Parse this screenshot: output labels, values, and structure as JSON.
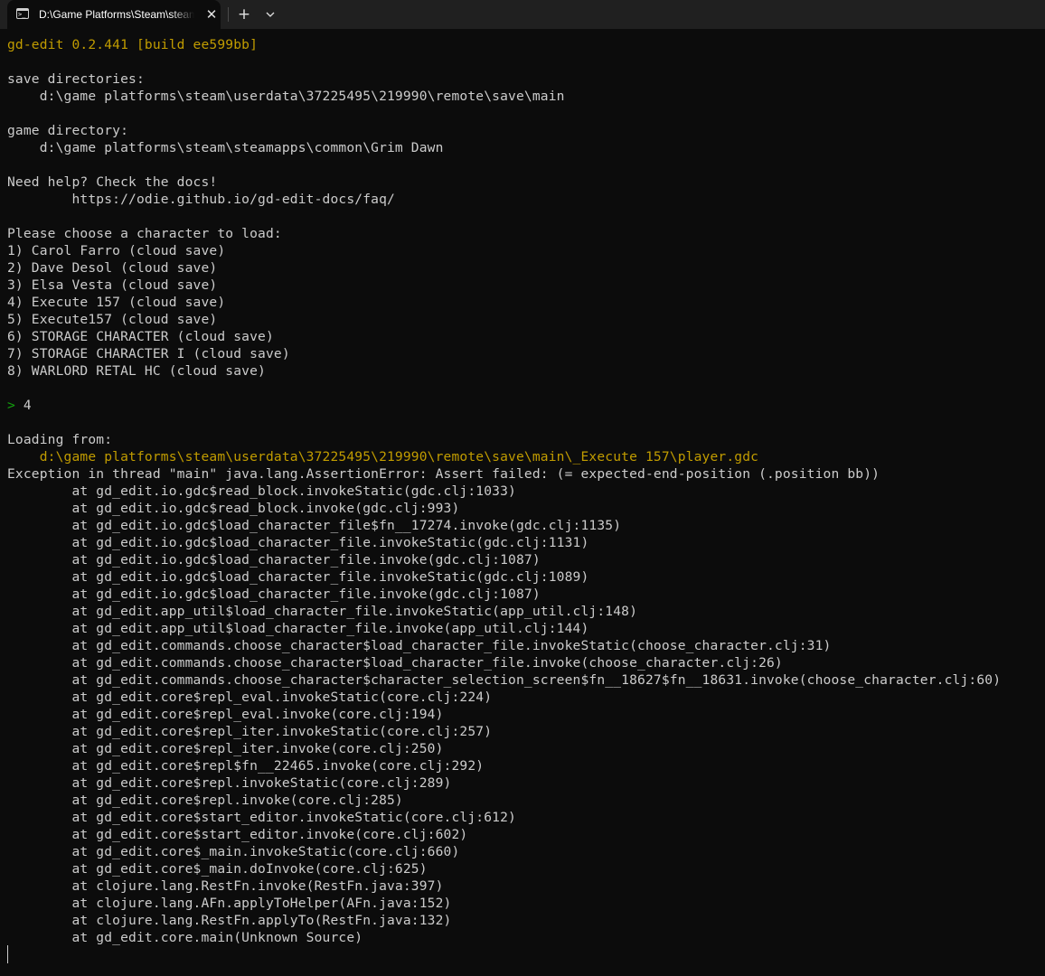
{
  "tab": {
    "icon": "terminal-icon",
    "icon_glyph": ">_",
    "title": "D:\\Game Platforms\\Steam\\steamapps\\common\\Grim Dawn\\gd-edit.exe",
    "close_glyph": "✕",
    "new_tab_glyph": "+",
    "dropdown_icon": "chevron-down-icon"
  },
  "colors": {
    "background": "#0c0c0c",
    "foreground": "#cccccc",
    "yellow": "#c19c00",
    "green": "#13a10e",
    "tabbar": "#202020"
  },
  "terminal": {
    "header": "gd-edit 0.2.441 [build ee599bb]",
    "save_dirs_label": "save directories:",
    "save_dir": "    d:\\game platforms\\steam\\userdata\\37225495\\219990\\remote\\save\\main",
    "game_dir_label": "game directory:",
    "game_dir": "    d:\\game platforms\\steam\\steamapps\\common\\Grim Dawn",
    "help_line": "Need help? Check the docs!",
    "help_url": "        https://odie.github.io/gd-edit-docs/faq/",
    "choose_prompt": "Please choose a character to load:",
    "characters": [
      "1) Carol Farro (cloud save)",
      "2) Dave Desol (cloud save)",
      "3) Elsa Vesta (cloud save)",
      "4) Execute 157 (cloud save)",
      "5) Execute157 (cloud save)",
      "6) STORAGE CHARACTER (cloud save)",
      "7) STORAGE CHARACTER I (cloud save)",
      "8) WARLORD RETAL HC (cloud save)"
    ],
    "prompt_symbol": ">",
    "prompt_input": " 4",
    "loading_label": "Loading from:",
    "loading_path": "    d:\\game platforms\\steam\\userdata\\37225495\\219990\\remote\\save\\main\\_Execute 157\\player.gdc",
    "exception": "Exception in thread \"main\" java.lang.AssertionError: Assert failed: (= expected-end-position (.position bb))",
    "stack_trace": [
      "        at gd_edit.io.gdc$read_block.invokeStatic(gdc.clj:1033)",
      "        at gd_edit.io.gdc$read_block.invoke(gdc.clj:993)",
      "        at gd_edit.io.gdc$load_character_file$fn__17274.invoke(gdc.clj:1135)",
      "        at gd_edit.io.gdc$load_character_file.invokeStatic(gdc.clj:1131)",
      "        at gd_edit.io.gdc$load_character_file.invoke(gdc.clj:1087)",
      "        at gd_edit.io.gdc$load_character_file.invokeStatic(gdc.clj:1089)",
      "        at gd_edit.io.gdc$load_character_file.invoke(gdc.clj:1087)",
      "        at gd_edit.app_util$load_character_file.invokeStatic(app_util.clj:148)",
      "        at gd_edit.app_util$load_character_file.invoke(app_util.clj:144)",
      "        at gd_edit.commands.choose_character$load_character_file.invokeStatic(choose_character.clj:31)",
      "        at gd_edit.commands.choose_character$load_character_file.invoke(choose_character.clj:26)",
      "        at gd_edit.commands.choose_character$character_selection_screen$fn__18627$fn__18631.invoke(choose_character.clj:60)",
      "        at gd_edit.core$repl_eval.invokeStatic(core.clj:224)",
      "        at gd_edit.core$repl_eval.invoke(core.clj:194)",
      "        at gd_edit.core$repl_iter.invokeStatic(core.clj:257)",
      "        at gd_edit.core$repl_iter.invoke(core.clj:250)",
      "        at gd_edit.core$repl$fn__22465.invoke(core.clj:292)",
      "        at gd_edit.core$repl.invokeStatic(core.clj:289)",
      "        at gd_edit.core$repl.invoke(core.clj:285)",
      "        at gd_edit.core$start_editor.invokeStatic(core.clj:612)",
      "        at gd_edit.core$start_editor.invoke(core.clj:602)",
      "        at gd_edit.core$_main.invokeStatic(core.clj:660)",
      "        at gd_edit.core$_main.doInvoke(core.clj:625)",
      "        at clojure.lang.RestFn.invoke(RestFn.java:397)",
      "        at clojure.lang.AFn.applyToHelper(AFn.java:152)",
      "        at clojure.lang.RestFn.applyTo(RestFn.java:132)",
      "        at gd_edit.core.main(Unknown Source)"
    ]
  }
}
